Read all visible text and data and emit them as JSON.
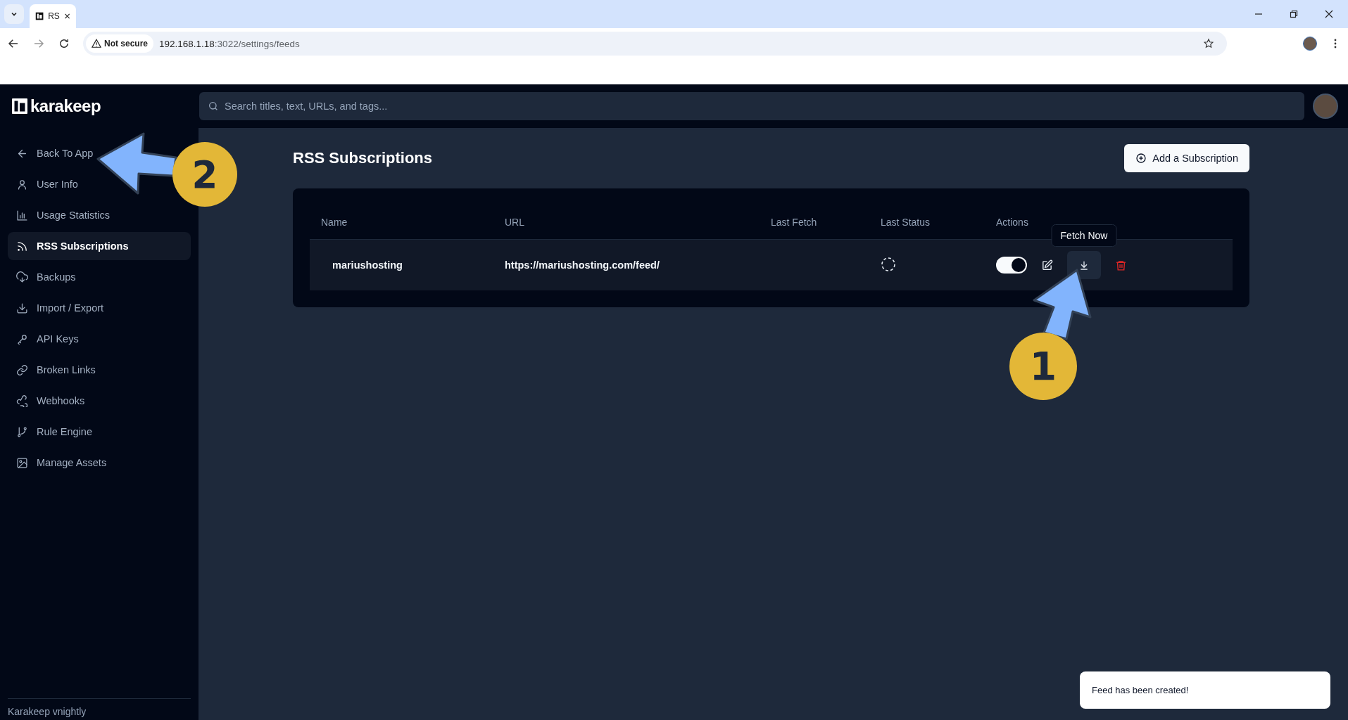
{
  "browser": {
    "tab_title": "RS",
    "security_label": "Not secure",
    "url_host": "192.168.1.18",
    "url_path": ":3022/settings/feeds"
  },
  "header": {
    "logo_text": "karakeep",
    "search_placeholder": "Search titles, text, URLs, and tags..."
  },
  "sidebar": {
    "items": [
      {
        "label": "Back To App",
        "selected": false
      },
      {
        "label": "User Info",
        "selected": false
      },
      {
        "label": "Usage Statistics",
        "selected": false
      },
      {
        "label": "RSS Subscriptions",
        "selected": true
      },
      {
        "label": "Backups",
        "selected": false
      },
      {
        "label": "Import / Export",
        "selected": false
      },
      {
        "label": "API Keys",
        "selected": false
      },
      {
        "label": "Broken Links",
        "selected": false
      },
      {
        "label": "Webhooks",
        "selected": false
      },
      {
        "label": "Rule Engine",
        "selected": false
      },
      {
        "label": "Manage Assets",
        "selected": false
      }
    ],
    "footer": "Karakeep vnightly"
  },
  "page": {
    "title": "RSS Subscriptions",
    "add_button": "Add a Subscription",
    "table": {
      "columns": [
        "Name",
        "URL",
        "Last Fetch",
        "Last Status",
        "Actions"
      ],
      "rows": [
        {
          "name": "mariushosting",
          "url": "https://mariushosting.com/feed/",
          "enabled": true
        }
      ]
    },
    "tooltip": "Fetch Now"
  },
  "toast": "Feed has been created!",
  "annotations": [
    {
      "number": "1"
    },
    {
      "number": "2"
    }
  ]
}
